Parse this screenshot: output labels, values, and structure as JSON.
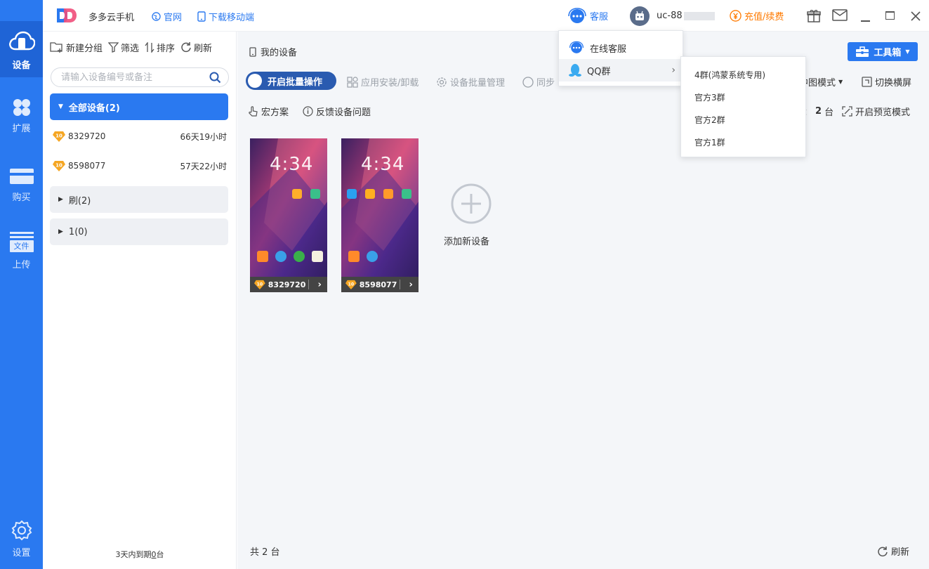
{
  "nav": {
    "items": [
      {
        "label": "设备"
      },
      {
        "label": "扩展"
      },
      {
        "label": "购买"
      },
      {
        "label": "上传",
        "icon_text": "文件"
      },
      {
        "label": "设置"
      }
    ]
  },
  "titlebar": {
    "app_name": "多多云手机",
    "link_official": "官网",
    "link_download": "下载移动端",
    "service": "客服",
    "user": "uc-88",
    "recharge": "充值/续费"
  },
  "sidebar": {
    "tools": {
      "new_group": "新建分组",
      "filter": "筛选",
      "sort": "排序",
      "refresh": "刷新"
    },
    "search_placeholder": "请输入设备编号或备注",
    "group_all": "全部设备(2)",
    "devices": [
      {
        "id": "8329720",
        "time": "66天19小时",
        "level": "10"
      },
      {
        "id": "8598077",
        "time": "57天22小时",
        "level": "10"
      }
    ],
    "group2": "刷(2)",
    "group3": "1(0)",
    "expire_prefix": "3天内到期",
    "expire_count": "0",
    "expire_suffix": "台"
  },
  "main": {
    "my_devices": "我的设备",
    "toolbox": "工具箱",
    "batch_toggle": "开启批量操作",
    "app_install": "应用安装/卸载",
    "batch_manage": "设备批量管理",
    "sync": "同步",
    "view_mode": "中图模式",
    "switch_landscape": "切换横屏",
    "macro": "宏方案",
    "feedback": "反馈设备问题",
    "count_prefix": "：",
    "count_value": "2",
    "count_unit": "台",
    "preview_mode": "开启预览模式",
    "phones": [
      {
        "id": "8329720",
        "clock": "4:34",
        "level": "10"
      },
      {
        "id": "8598077",
        "clock": "4:34",
        "level": "10"
      }
    ],
    "add_device": "添加新设备",
    "total": "共 2 台",
    "refresh": "刷新"
  },
  "dropdown": {
    "online_service": "在线客服",
    "qq_group": "QQ群",
    "qq_groups": [
      "4群(鸿蒙系统专用)",
      "官方3群",
      "官方2群",
      "官方1群"
    ]
  },
  "colors": {
    "accent": "#2a79f0",
    "recharge": "#ff7a00",
    "toggle": "#2a5bb0"
  }
}
